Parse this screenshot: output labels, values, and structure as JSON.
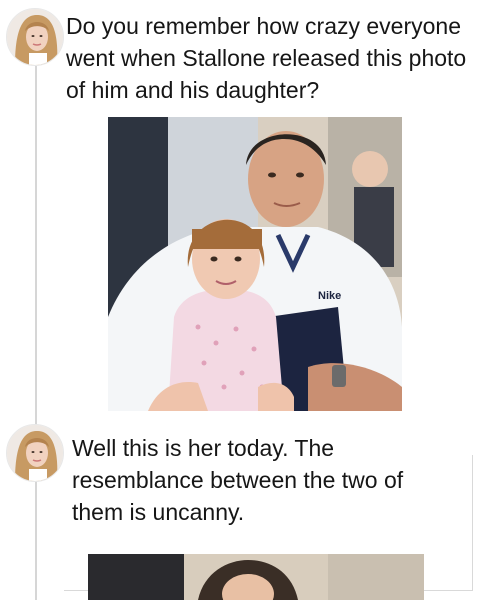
{
  "posts": [
    {
      "text": "Do you remember how crazy everyone went when Stallone released this photo of him and his daughter?",
      "image_logo_text": "Nike"
    },
    {
      "text": "Well this is her today. The resemblance between the two of them is uncanny."
    }
  ]
}
